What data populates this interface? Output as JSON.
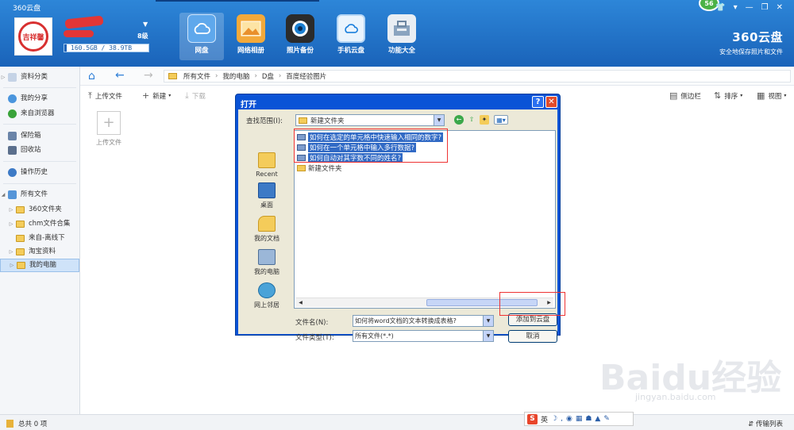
{
  "app": {
    "title": "360云盘"
  },
  "user": {
    "level": "8级",
    "quota": "160.5GB / 38.9TB",
    "badge": "56",
    "avatar_seal": "吉祥馨"
  },
  "nav": {
    "tabs": [
      {
        "label": "网盘",
        "icon": "cloud-icon",
        "active": true
      },
      {
        "label": "网络相册",
        "icon": "photo-album-icon"
      },
      {
        "label": "照片备份",
        "icon": "camera-icon"
      },
      {
        "label": "手机云盘",
        "icon": "phone-cloud-icon"
      },
      {
        "label": "功能大全",
        "icon": "toolbox-icon"
      }
    ]
  },
  "brand": {
    "name": "360云盘",
    "slogan": "安全地保存照片和文件"
  },
  "sidebar": {
    "items": [
      {
        "label": "资料分类"
      },
      {
        "label": "我的分享"
      },
      {
        "label": "来自浏览器"
      },
      {
        "label": "保险箱"
      },
      {
        "label": "回收站"
      },
      {
        "label": "操作历史"
      },
      {
        "label": "所有文件"
      },
      {
        "label": "360文件夹"
      },
      {
        "label": "chm文件合集"
      },
      {
        "label": "来自-离线下"
      },
      {
        "label": "淘宝资料"
      },
      {
        "label": "我的电脑"
      }
    ]
  },
  "breadcrumb": [
    "所有文件",
    "我的电脑",
    "D盘",
    "百度经验图片"
  ],
  "toolbar": {
    "upload": "上传文件",
    "new": "新建",
    "download": "下载",
    "sidebar": "侧边栏",
    "sort": "排序",
    "view": "视图"
  },
  "upload_tile": {
    "label": "上传文件"
  },
  "status": {
    "total": "总共 0 项",
    "transfer": "传输列表"
  },
  "ime": {
    "label": "英"
  },
  "dialog": {
    "title": "打开",
    "lookin_label": "查找范围(I):",
    "lookin_value": "新建文件夹",
    "places": [
      "Recent",
      "桌面",
      "我的文档",
      "我的电脑",
      "网上邻居"
    ],
    "files": [
      {
        "name": "如何在选定的单元格中快速输入相同的数字?",
        "selected": true
      },
      {
        "name": "如何在一个单元格中输入多行数据?",
        "selected": true
      },
      {
        "name": "如何自动对其字数不同的姓名?",
        "selected": true
      },
      {
        "name": "新建文件夹",
        "selected": false
      }
    ],
    "filename_label": "文件名(N):",
    "filename_value": "如何将word文档的文本转换成表格?",
    "filetype_label": "文件类型(T):",
    "filetype_value": "所有文件(*.*)",
    "add_button": "添加到云盘",
    "cancel_button": "取消"
  },
  "watermark": {
    "text": "Baidu经验",
    "url": "jingyan.baidu.com"
  }
}
